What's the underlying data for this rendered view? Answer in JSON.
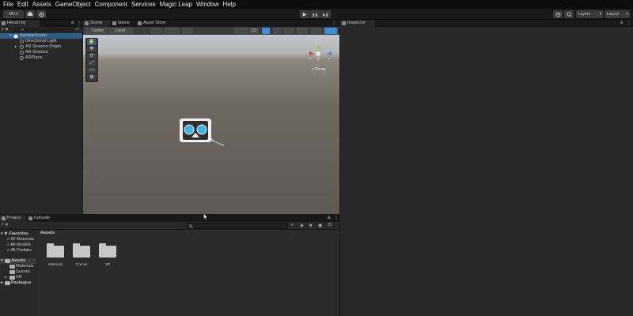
{
  "menubar": {
    "items": [
      "File",
      "Edit",
      "Assets",
      "GameObject",
      "Component",
      "Services",
      "Magic Leap",
      "Window",
      "Help"
    ]
  },
  "toolbar": {
    "account_label": "MD ▾",
    "cloud_icon": "cloud-icon",
    "collab_icon": "gear-icon",
    "play_icon": "▶",
    "pause_icon": "❚❚",
    "step_icon": "▶❚",
    "history_icon": "history-icon",
    "search_icon": "search-icon",
    "layers_label": "Layers",
    "layout_label": "Layout"
  },
  "hierarchy": {
    "tab_label": "Hierarchy",
    "add_label": "+ ▾",
    "search_placeholder": "All",
    "scene_name": "SampleScene",
    "items": [
      "Directional Light",
      "AR Session Origin",
      "AR Session",
      "ARPlane"
    ]
  },
  "scene": {
    "tabs": [
      "Scene",
      "Game",
      "Asset Store"
    ],
    "pivot_label": "Center",
    "space_label": "Local",
    "mode_2d": "2D",
    "persp_label": "< Persp",
    "gizmo_axis_x": "x",
    "gizmo_axis_y": "y",
    "gizmo_axis_z": "z",
    "tools": [
      "✋",
      "✥",
      "⟳",
      "⤢",
      "▭",
      "⊞"
    ]
  },
  "inspector": {
    "tab_label": "Inspector"
  },
  "project": {
    "tabs": [
      "Project",
      "Console"
    ],
    "favorites_label": "Favorites",
    "favorites": [
      "All Materials",
      "All Models",
      "All Prefabs"
    ],
    "assets_label": "Assets",
    "asset_tree": [
      "Materials",
      "Scenes",
      "XR"
    ],
    "packages_label": "Packages",
    "breadcrumb": "Assets",
    "folders": [
      "Materials",
      "Scenes",
      "XR"
    ],
    "count_label": "21"
  },
  "colors": {
    "menubar_bg": "#0d0d0d",
    "panel_bg": "#282828",
    "selection": "#2c5d87",
    "accent_blue": "#3d8fd6"
  }
}
